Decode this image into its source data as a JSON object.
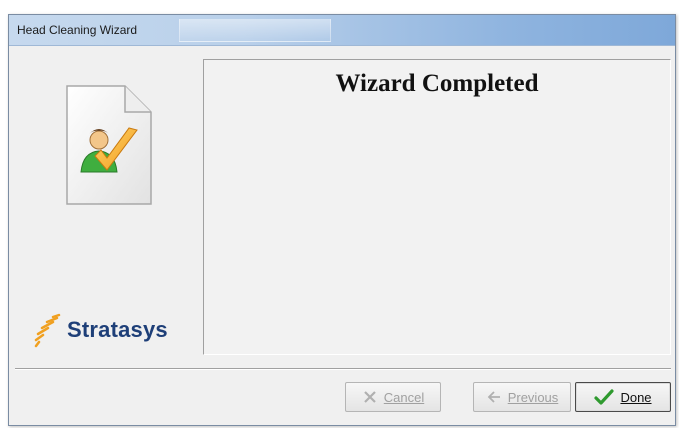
{
  "window": {
    "title": "Head Cleaning Wizard"
  },
  "sidebar": {
    "icon": "document-user-check-icon",
    "logo_text": "Stratasys",
    "logo_icon": "stratasys-logo-icon"
  },
  "content": {
    "heading": "Wizard Completed"
  },
  "buttons": {
    "cancel": {
      "label": "Cancel",
      "enabled": false,
      "icon": "cancel-x-icon"
    },
    "previous": {
      "label": "Previous",
      "enabled": false,
      "icon": "previous-arrow-icon"
    },
    "done": {
      "label": "Done",
      "enabled": true,
      "icon": "checkmark-icon"
    }
  },
  "colors": {
    "titlebar_start": "#c6d9ee",
    "titlebar_end": "#7ea8d9",
    "logo_text": "#1e3f78",
    "logo_accent": "#f0a020",
    "done_check": "#2f9a2f"
  }
}
